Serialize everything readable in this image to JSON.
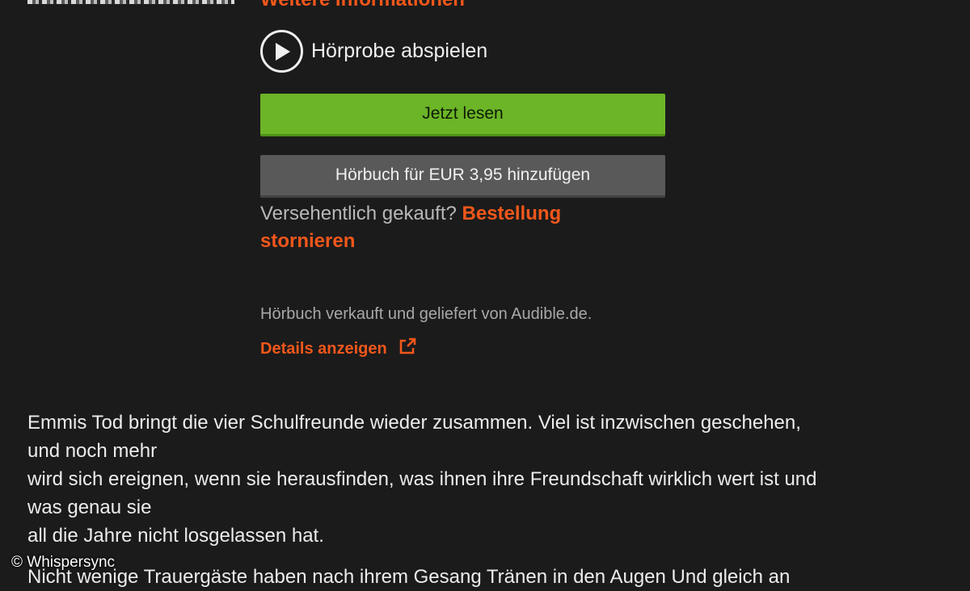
{
  "header": {
    "more_info_label": "Weitere Informationen"
  },
  "audio_sample": {
    "label": "Hörprobe abspielen",
    "icon": "play-icon"
  },
  "actions": {
    "read_now_label": "Jetzt lesen",
    "add_audiobook_label": "Hörbuch für EUR 3,95 hinzufügen"
  },
  "accidental_purchase": {
    "question": "Versehentlich gekauft?",
    "cancel_link": "Bestellung stornieren"
  },
  "seller": {
    "sold_by_text": "Hörbuch verkauft und geliefert von Audible.de.",
    "details_link": "Details anzeigen",
    "details_icon": "external-link-icon"
  },
  "description": {
    "paragraph_1_lines": [
      "Emmis Tod bringt die vier Schulfreunde wieder zusammen. Viel ist inzwischen geschehen,",
      "und noch mehr",
      "wird sich ereignen, wenn sie herausfinden, was ihnen ihre Freundschaft wirklich wert ist und",
      "was genau sie",
      "all die Jahre nicht losgelassen hat."
    ],
    "paragraph_2": "Nicht wenige Trauergäste haben nach ihrem Gesang Tränen in den Augen Und gleich an"
  },
  "credit": "© Whispersync",
  "colors": {
    "background": "#1b1b1b",
    "accent_orange": "#f2571b",
    "read_button_green": "#6bb527",
    "audio_button_gray": "#595959"
  }
}
